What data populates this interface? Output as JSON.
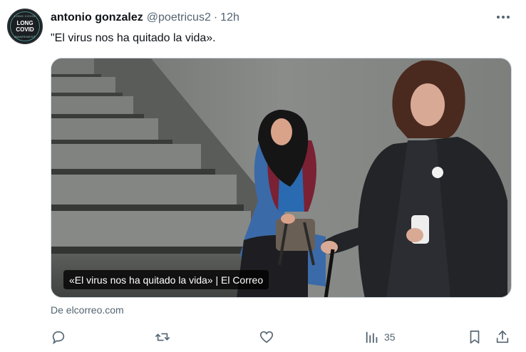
{
  "author": {
    "name": "antonio gonzalez",
    "handle": "@poetricus2",
    "separator": "·",
    "time": "12h",
    "avatar": {
      "ring_top": "LONG COVID",
      "line1": "LONG",
      "line2": "COVID",
      "ring_bottom": "AWARENESS"
    }
  },
  "tweet": {
    "text": "\"El virus nos ha quitado la vida»."
  },
  "card": {
    "caption": "«El virus nos ha quitado la vida» | El Correo",
    "source": "De elcorreo.com"
  },
  "actions": {
    "views_count": "35"
  },
  "icons": {
    "more": "more-dots-icon",
    "reply": "reply-icon",
    "retweet": "retweet-icon",
    "like": "heart-icon",
    "views": "views-chart-icon",
    "bookmark": "bookmark-icon",
    "share": "share-icon"
  },
  "colors": {
    "text": "#0f1419",
    "secondary": "#536471",
    "border": "#cfd9de"
  }
}
